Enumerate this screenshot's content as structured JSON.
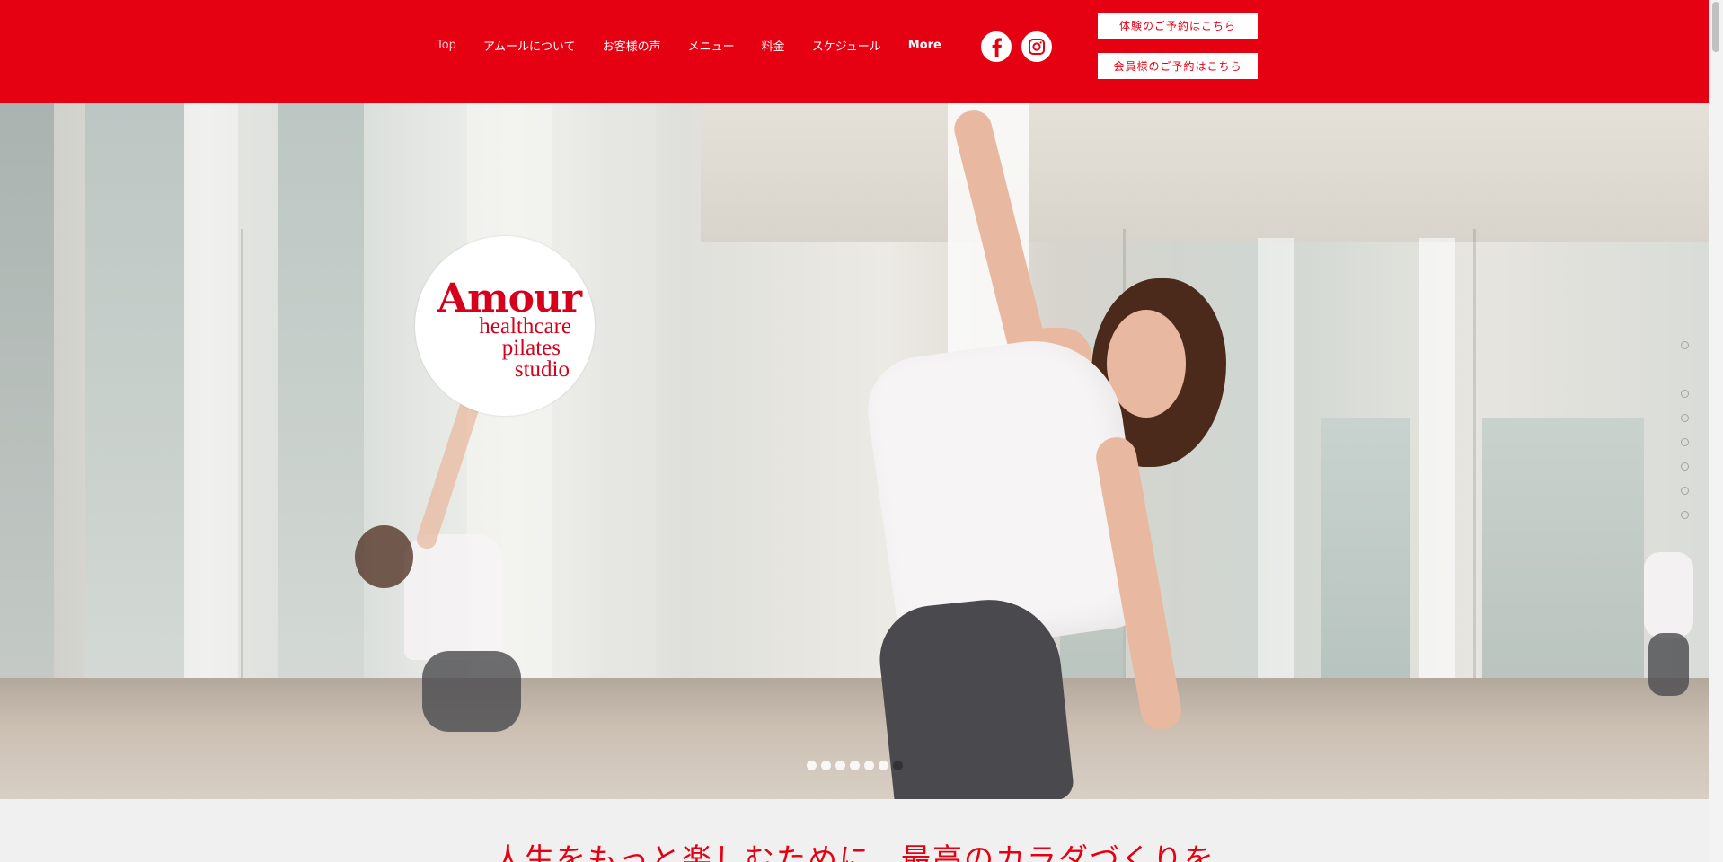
{
  "header": {
    "nav": [
      {
        "label": "Top"
      },
      {
        "label": "アムールについて"
      },
      {
        "label": "お客様の声"
      },
      {
        "label": "メニュー"
      },
      {
        "label": "料金"
      },
      {
        "label": "スケジュール"
      },
      {
        "label": "More"
      }
    ],
    "social": {
      "facebook_icon": "facebook-icon",
      "instagram_icon": "instagram-icon"
    },
    "cta_trial": "体験のご予約はこちら",
    "cta_member": "会員様のご予約はこちら",
    "colors": {
      "brand_red": "#e50012",
      "white": "#ffffff"
    }
  },
  "hero": {
    "logo": {
      "main": "Amour",
      "line1": "healthcare",
      "line2": "pilates",
      "line3": "studio"
    },
    "slides": {
      "count": 7,
      "current": 7
    }
  },
  "tagline": "人生をもっと楽しむために、最高のカラダづくりを"
}
